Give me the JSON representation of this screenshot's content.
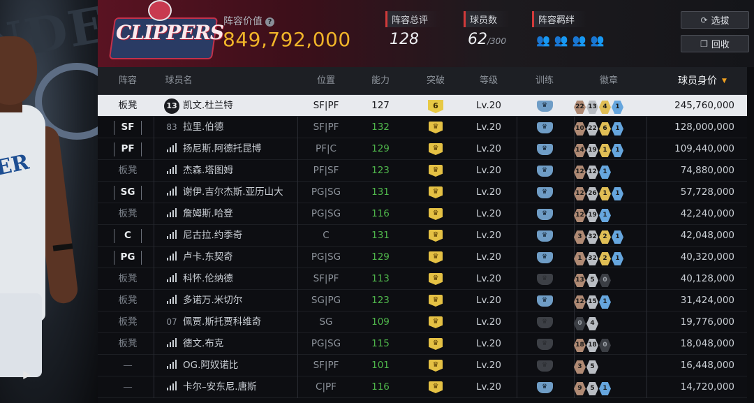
{
  "header": {
    "team_logo_text": "CLIPPERS",
    "value_label": "阵容价值",
    "value": "849,792,000",
    "rating_label": "阵容总评",
    "rating": "128",
    "players_label": "球员数",
    "players_count": "62",
    "players_max": "/300",
    "bonds_label": "阵容羁绊",
    "bond_icons": [
      "bond-bronze-icon",
      "bond-silver-icon",
      "bond-gold-icon",
      "bond-blue-icon"
    ],
    "select_label": "选拔",
    "recycle_label": "回收"
  },
  "table": {
    "columns": {
      "role": "阵容",
      "name": "球员名",
      "position": "位置",
      "ability": "能力",
      "breakthrough": "突破",
      "level": "等级",
      "training": "训练",
      "badges": "徽章",
      "price": "球员身价"
    },
    "rows": [
      {
        "role": "板凳",
        "role_type": "bench",
        "jersey": "13",
        "jersey_style": "circle",
        "name": "凯文.杜兰特",
        "position": "SF|PF",
        "ability": "127",
        "ability_green": false,
        "break_num": "6",
        "level": "Lv.20",
        "training": "on",
        "badges": [
          {
            "t": "bronze",
            "v": "22"
          },
          {
            "t": "silver",
            "v": "13"
          },
          {
            "t": "gold",
            "v": "4"
          },
          {
            "t": "blue",
            "v": "1"
          }
        ],
        "price": "245,760,000",
        "selected": true
      },
      {
        "role": "SF",
        "role_type": "pos",
        "jersey": "83",
        "jersey_style": "num",
        "name": "拉里.伯德",
        "position": "SF|PF",
        "ability": "132",
        "ability_green": true,
        "break_num": "",
        "level": "Lv.20",
        "training": "on",
        "badges": [
          {
            "t": "bronze",
            "v": "10"
          },
          {
            "t": "silver",
            "v": "22"
          },
          {
            "t": "gold",
            "v": "6"
          },
          {
            "t": "blue",
            "v": "1"
          }
        ],
        "price": "128,000,000"
      },
      {
        "role": "PF",
        "role_type": "pos",
        "jersey": "",
        "jersey_style": "bars",
        "name": "扬尼斯.阿德托昆博",
        "position": "PF|C",
        "ability": "129",
        "ability_green": true,
        "break_num": "",
        "level": "Lv.20",
        "training": "on",
        "badges": [
          {
            "t": "bronze",
            "v": "14"
          },
          {
            "t": "silver",
            "v": "19"
          },
          {
            "t": "gold",
            "v": "1"
          },
          {
            "t": "blue",
            "v": "1"
          }
        ],
        "price": "109,440,000"
      },
      {
        "role": "板凳",
        "role_type": "bench",
        "jersey": "",
        "jersey_style": "bars",
        "name": "杰森.塔图姆",
        "position": "PF|SF",
        "ability": "123",
        "ability_green": true,
        "break_num": "",
        "level": "Lv.20",
        "training": "on",
        "badges": [
          {
            "t": "bronze",
            "v": "12"
          },
          {
            "t": "silver",
            "v": "12"
          },
          {
            "t": "blue",
            "v": "1"
          }
        ],
        "price": "74,880,000"
      },
      {
        "role": "SG",
        "role_type": "pos",
        "jersey": "",
        "jersey_style": "bars",
        "name": "谢伊.吉尔杰斯.亚历山大",
        "position": "PG|SG",
        "ability": "131",
        "ability_green": true,
        "break_num": "",
        "level": "Lv.20",
        "training": "on",
        "badges": [
          {
            "t": "bronze",
            "v": "12"
          },
          {
            "t": "silver",
            "v": "26"
          },
          {
            "t": "gold",
            "v": "1"
          },
          {
            "t": "blue",
            "v": "1"
          }
        ],
        "price": "57,728,000"
      },
      {
        "role": "板凳",
        "role_type": "bench",
        "jersey": "",
        "jersey_style": "bars",
        "name": "詹姆斯.哈登",
        "position": "PG|SG",
        "ability": "116",
        "ability_green": true,
        "break_num": "",
        "level": "Lv.20",
        "training": "on",
        "badges": [
          {
            "t": "bronze",
            "v": "12"
          },
          {
            "t": "silver",
            "v": "19"
          },
          {
            "t": "blue",
            "v": "1"
          }
        ],
        "price": "42,240,000"
      },
      {
        "role": "C",
        "role_type": "pos",
        "jersey": "",
        "jersey_style": "bars",
        "name": "尼古拉.约季奇",
        "position": "C",
        "ability": "131",
        "ability_green": true,
        "break_num": "",
        "level": "Lv.20",
        "training": "on",
        "badges": [
          {
            "t": "bronze",
            "v": "3"
          },
          {
            "t": "silver",
            "v": "32"
          },
          {
            "t": "gold",
            "v": "2"
          },
          {
            "t": "blue",
            "v": "1"
          }
        ],
        "price": "42,048,000"
      },
      {
        "role": "PG",
        "role_type": "pos",
        "jersey": "",
        "jersey_style": "bars",
        "name": "卢卡.东契奇",
        "position": "PG|SG",
        "ability": "129",
        "ability_green": true,
        "break_num": "",
        "level": "Lv.20",
        "training": "on",
        "badges": [
          {
            "t": "bronze",
            "v": "1"
          },
          {
            "t": "silver",
            "v": "32"
          },
          {
            "t": "gold",
            "v": "2"
          },
          {
            "t": "blue",
            "v": "1"
          }
        ],
        "price": "40,320,000"
      },
      {
        "role": "板凳",
        "role_type": "bench",
        "jersey": "",
        "jersey_style": "bars",
        "name": "科怀.伦纳德",
        "position": "SF|PF",
        "ability": "113",
        "ability_green": true,
        "break_num": "",
        "level": "Lv.20",
        "training": "off",
        "badges": [
          {
            "t": "bronze",
            "v": "13"
          },
          {
            "t": "silver",
            "v": "5"
          },
          {
            "t": "dark",
            "v": "0"
          }
        ],
        "price": "40,128,000"
      },
      {
        "role": "板凳",
        "role_type": "bench",
        "jersey": "",
        "jersey_style": "bars",
        "name": "多诺万.米切尔",
        "position": "SG|PG",
        "ability": "123",
        "ability_green": true,
        "break_num": "",
        "level": "Lv.20",
        "training": "on",
        "badges": [
          {
            "t": "bronze",
            "v": "12"
          },
          {
            "t": "silver",
            "v": "15"
          },
          {
            "t": "blue",
            "v": "1"
          }
        ],
        "price": "31,424,000"
      },
      {
        "role": "板凳",
        "role_type": "bench",
        "jersey": "07",
        "jersey_style": "num",
        "name": "佩贾.斯托贾科维奇",
        "position": "SG",
        "ability": "109",
        "ability_green": true,
        "break_num": "",
        "level": "Lv.20",
        "training": "off",
        "badges": [
          {
            "t": "dark",
            "v": "0"
          },
          {
            "t": "silver",
            "v": "4"
          }
        ],
        "price": "19,776,000"
      },
      {
        "role": "板凳",
        "role_type": "bench",
        "jersey": "",
        "jersey_style": "bars",
        "name": "德文.布克",
        "position": "PG|SG",
        "ability": "115",
        "ability_green": true,
        "break_num": "",
        "level": "Lv.20",
        "training": "off",
        "badges": [
          {
            "t": "bronze",
            "v": "18"
          },
          {
            "t": "silver",
            "v": "18"
          },
          {
            "t": "dark",
            "v": "0"
          }
        ],
        "price": "18,048,000"
      },
      {
        "role": "—",
        "role_type": "none",
        "jersey": "",
        "jersey_style": "bars",
        "name": "OG.阿奴诺比",
        "position": "SF|PF",
        "ability": "101",
        "ability_green": true,
        "break_num": "",
        "level": "Lv.20",
        "training": "off",
        "badges": [
          {
            "t": "bronze",
            "v": "3"
          },
          {
            "t": "silver",
            "v": "5"
          }
        ],
        "price": "16,448,000"
      },
      {
        "role": "—",
        "role_type": "none",
        "jersey": "",
        "jersey_style": "bars",
        "name": "卡尔–安东尼.唐斯",
        "position": "C|PF",
        "ability": "116",
        "ability_green": true,
        "break_num": "",
        "level": "Lv.20",
        "training": "on",
        "badges": [
          {
            "t": "bronze",
            "v": "9"
          },
          {
            "t": "silver",
            "v": "5"
          },
          {
            "t": "blue",
            "v": "1"
          }
        ],
        "price": "14,720,000"
      }
    ]
  }
}
